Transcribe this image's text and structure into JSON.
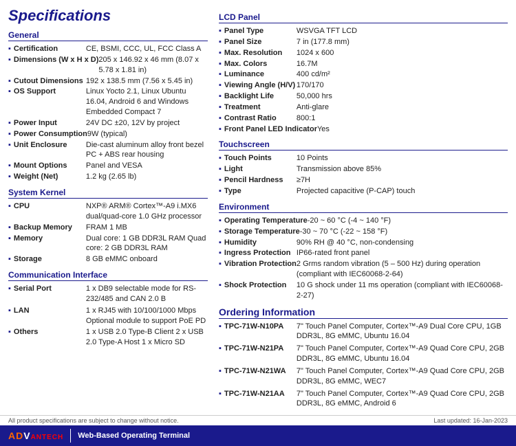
{
  "page": {
    "title": "Specifications"
  },
  "footer": {
    "brand_adv": "AD",
    "brand_adv_accent": "V",
    "brand_tech": "ANTECH",
    "tagline": "Web-Based Operating Terminal",
    "last_updated_label": "Last updated: 16-Jan-2023",
    "bottom_note": "All product specifications are subject to change without notice."
  },
  "left": {
    "general_title": "General",
    "general_items": [
      {
        "label": "Certification",
        "value": "CE, BSMI, CCC, UL, FCC Class A"
      },
      {
        "label": "Dimensions (W x H x D)",
        "value": "205 x 146.92 x 46 mm (8.07 x 5.78 x 1.81 in)"
      },
      {
        "label": "Cutout Dimensions",
        "value": "192 x 138.5 mm (7.56 x 5.45 in)"
      },
      {
        "label": "OS Support",
        "value": "Linux Yocto 2.1, Linux Ubuntu 16.04, Android 6 and Windows Embedded Compact 7"
      },
      {
        "label": "Power Input",
        "value": "24V DC ±20, 12V by project"
      },
      {
        "label": "Power Consumption",
        "value": "9W (typical)"
      },
      {
        "label": "Unit Enclosure",
        "value": "Die-cast aluminum alloy front bezel PC + ABS rear housing"
      },
      {
        "label": "Mount Options",
        "value": "Panel and VESA"
      },
      {
        "label": "Weight (Net)",
        "value": "1.2 kg (2.65 lb)"
      }
    ],
    "system_kernel_title": "System Kernel",
    "system_items": [
      {
        "label": "CPU",
        "value": "NXP® ARM® Cortex™-A9 i.MX6 dual/quad-core 1.0 GHz processor"
      },
      {
        "label": "Backup Memory",
        "value": "FRAM 1 MB"
      },
      {
        "label": "Memory",
        "value": "Dual core: 1 GB DDR3L RAM Quad core: 2 GB DDR3L RAM"
      },
      {
        "label": "Storage",
        "value": "8 GB eMMC onboard"
      }
    ],
    "comm_title": "Communication Interface",
    "comm_items": [
      {
        "label": "Serial Port",
        "value": "1 x DB9 selectable mode for RS-232/485 and CAN 2.0 B"
      },
      {
        "label": "LAN",
        "value": "1 x RJ45 with 10/100/1000 Mbps Optional module to support PoE PD"
      },
      {
        "label": "Others",
        "value": "1 x USB 2.0 Type-B Client 2 x USB 2.0 Type-A Host 1 x Micro SD"
      }
    ]
  },
  "right": {
    "lcd_title": "LCD Panel",
    "lcd_items": [
      {
        "label": "Panel Type",
        "value": "WSVGA TFT LCD"
      },
      {
        "label": "Panel Size",
        "value": "7 in (177.8 mm)"
      },
      {
        "label": "Max. Resolution",
        "value": "1024 x 600"
      },
      {
        "label": "Max. Colors",
        "value": "16.7M"
      },
      {
        "label": "Luminance",
        "value": "400 cd/m²"
      },
      {
        "label": "Viewing Angle (H/V)",
        "value": "170/170"
      },
      {
        "label": "Backlight Life",
        "value": "50,000 hrs"
      },
      {
        "label": "Treatment",
        "value": "Anti-glare"
      },
      {
        "label": "Contrast Ratio",
        "value": "800:1"
      },
      {
        "label": "Front Panel LED Indicator",
        "value": "Yes"
      }
    ],
    "touchscreen_title": "Touchscreen",
    "touch_items": [
      {
        "label": "Touch Points",
        "value": "10 Points"
      },
      {
        "label": "Light",
        "value": "Transmission above 85%"
      },
      {
        "label": "Pencil Hardness",
        "value": "≥7H"
      },
      {
        "label": "Type",
        "value": "Projected capacitive (P-CAP) touch"
      }
    ],
    "environment_title": "Environment",
    "env_items": [
      {
        "label": "Operating Temperature",
        "value": "-20 ~ 60 °C (-4 ~ 140 °F)"
      },
      {
        "label": "Storage Temperature",
        "value": "-30 ~ 70 °C (-22 ~ 158 °F)"
      },
      {
        "label": "Humidity",
        "value": "90% RH @ 40 °C, non-condensing"
      },
      {
        "label": "Ingress Protection",
        "value": "IP66-rated front panel"
      },
      {
        "label": "Vibration Protection",
        "value": "2 Grms random vibration (5 – 500 Hz) during operation (compliant with IEC60068-2-64)"
      },
      {
        "label": "Shock Protection",
        "value": "10 G shock under 11 ms operation (compliant with IEC60068-2-27)"
      }
    ],
    "ordering_title": "Ordering Information",
    "ordering_items": [
      {
        "code": "TPC-71W-N10PA",
        "desc": "7\" Touch Panel Computer, Cortex™-A9 Dual Core CPU, 1GB DDR3L, 8G eMMC, Ubuntu 16.04"
      },
      {
        "code": "TPC-71W-N21PA",
        "desc": "7\" Touch Panel Computer, Cortex™-A9 Quad Core CPU, 2GB DDR3L, 8G eMMC, Ubuntu 16.04"
      },
      {
        "code": "TPC-71W-N21WA",
        "desc": "7\" Touch Panel Computer, Cortex™-A9 Quad Core CPU, 2GB DDR3L, 8G eMMC, WEC7"
      },
      {
        "code": "TPC-71W-N21AA",
        "desc": "7\" Touch Panel Computer, Cortex™-A9 Quad Core CPU, 2GB DDR3L, 8G eMMC, Android 6"
      }
    ]
  }
}
